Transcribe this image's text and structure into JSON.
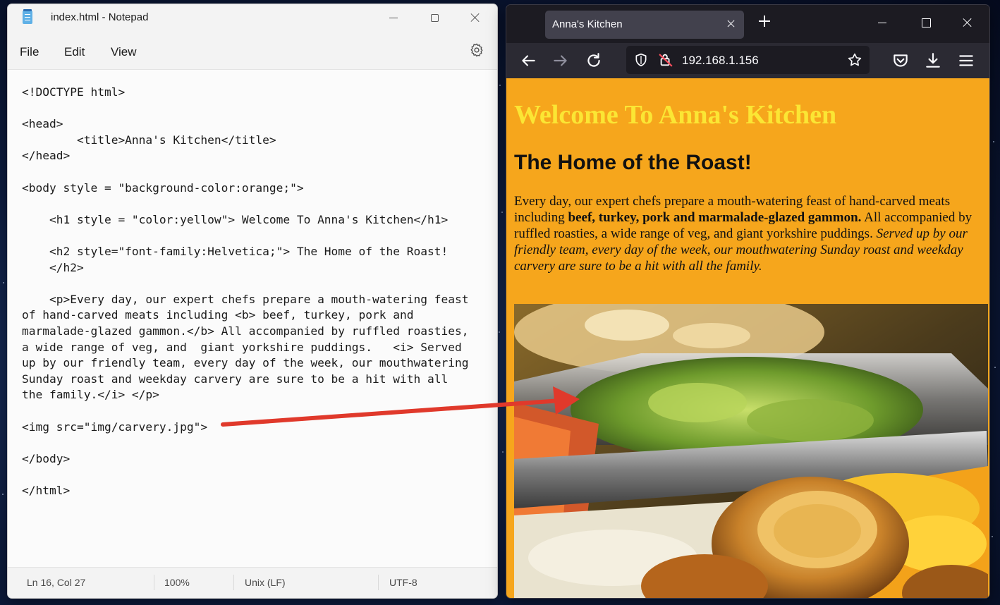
{
  "notepad": {
    "title": "index.html - Notepad",
    "menu": [
      "File",
      "Edit",
      "View"
    ],
    "code_lines": [
      "<!DOCTYPE html>",
      "",
      "<head>",
      "        <title>Anna's Kitchen</title>",
      "</head>",
      "",
      "<body style = \"background-color:orange;\">",
      "",
      "    <h1 style = \"color:yellow\"> Welcome To Anna's Kitchen</h1>",
      "",
      "    <h2 style=\"font-family:Helvetica;\"> The Home of the Roast!",
      "    </h2>",
      "",
      "    <p>Every day, our expert chefs prepare a mouth-watering feast",
      "of hand-carved meats including <b> beef, turkey, pork and",
      "marmalade-glazed gammon.</b> All accompanied by ruffled roasties,",
      "a wide range of veg, and  giant yorkshire puddings.   <i> Served",
      "up by our friendly team, every day of the week, our mouthwatering",
      "Sunday roast and weekday carvery are sure to be a hit with all",
      "the family.</i> </p>",
      "",
      "<img src=\"img/carvery.jpg\">",
      "",
      "</body>",
      "",
      "</html>"
    ],
    "status": {
      "position": "Ln 16, Col 27",
      "zoom": "100%",
      "line_ending": "Unix (LF)",
      "encoding": "UTF-8"
    }
  },
  "browser": {
    "tab_title": "Anna's Kitchen",
    "url": "192.168.1.156",
    "icons": [
      "back-icon",
      "forward-icon",
      "reload-icon",
      "shield-icon",
      "insecure-lock-icon",
      "star-icon",
      "pocket-icon",
      "download-icon",
      "menu-icon"
    ],
    "page": {
      "background": "#f6a61c",
      "h1": "Welcome To Anna's Kitchen",
      "h1_color": "#fbe634",
      "h2": "The Home of the Roast!",
      "p_intro": "Every day, our expert chefs prepare a mouth-watering feast of hand-carved meats including ",
      "p_bold": "beef, turkey, pork and marmalade-glazed gammon.",
      "p_mid": " All accompanied by ruffled roasties, a wide range of veg, and giant yorkshire puddings. ",
      "p_italic": "Served up by our friendly team, every day of the week, our mouthwatering Sunday roast and weekday carvery are sure to be a hit with all the family.",
      "image_alt": "carvery food image"
    }
  },
  "annotation": {
    "arrow_color": "#e0392b"
  }
}
